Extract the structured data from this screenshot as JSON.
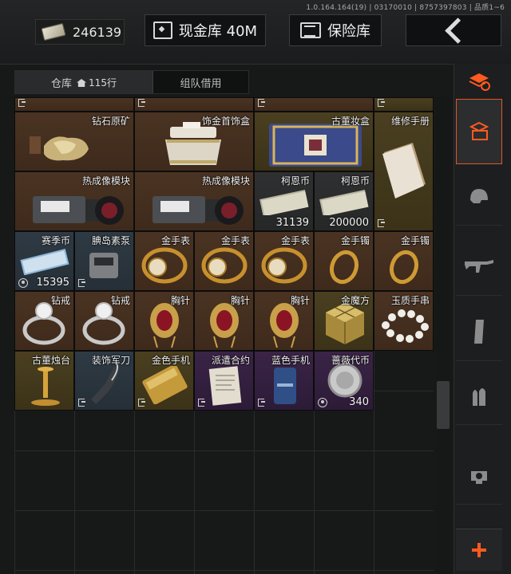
{
  "header": {
    "version": "1.0.164.164(19) | 03170010 | 8757397803 | 品质1~6",
    "cash_balance": "246139",
    "cash_vault_label": "现金库 40M",
    "safe_label": "保险库",
    "back_icon": "chevron-left-icon"
  },
  "tabs": {
    "warehouse_label": "仓库",
    "warehouse_count": "115行",
    "team_loan_label": "组队借用"
  },
  "colors": {
    "accent": "#ff5a1f",
    "rarity_brown": "#4a3322",
    "rarity_gold": "#4a3f20",
    "rarity_blue": "#2e3a44",
    "rarity_purple": "#3a2447"
  },
  "items": {
    "diamond_ore": "钻石原矿",
    "jewelry_box": "饰金首饰盒",
    "antique_box": "古董妆盒",
    "repair_manual": "维修手册",
    "thermal_1": "热成像模块",
    "thermal_2": "热成像模块",
    "koen_1": "柯恩币",
    "koen_1_qty": "31139",
    "koen_2": "柯恩币",
    "koen_2_qty": "200000",
    "season_coin": "赛季币",
    "season_coin_qty": "15395",
    "pump": "腆岛素泵",
    "watch_1": "金手表",
    "watch_2": "金手表",
    "watch_3": "金手表",
    "bracelet_1": "金手镯",
    "bracelet_2": "金手镯",
    "ring_1": "钻戒",
    "ring_2": "钻戒",
    "brooch_1": "胸针",
    "brooch_2": "胸针",
    "brooch_3": "胸针",
    "gold_cube": "金魔方",
    "jade_bracelet": "玉质手串",
    "candlestick": "古董烛台",
    "dagger": "装饰军刀",
    "gold_phone": "金色手机",
    "contract": "派遣合约",
    "blue_phone": "蓝色手机",
    "rose_token": "蔷薇代币",
    "rose_token_qty": "340"
  },
  "sidebar": [
    {
      "icon": "currency-stack-icon"
    },
    {
      "icon": "storage-box-icon",
      "active": true
    },
    {
      "icon": "helmet-icon"
    },
    {
      "icon": "rifle-icon"
    },
    {
      "icon": "magazine-icon"
    },
    {
      "icon": "ammo-icon"
    },
    {
      "icon": "scope-icon"
    },
    {
      "icon": "plus-icon"
    }
  ]
}
